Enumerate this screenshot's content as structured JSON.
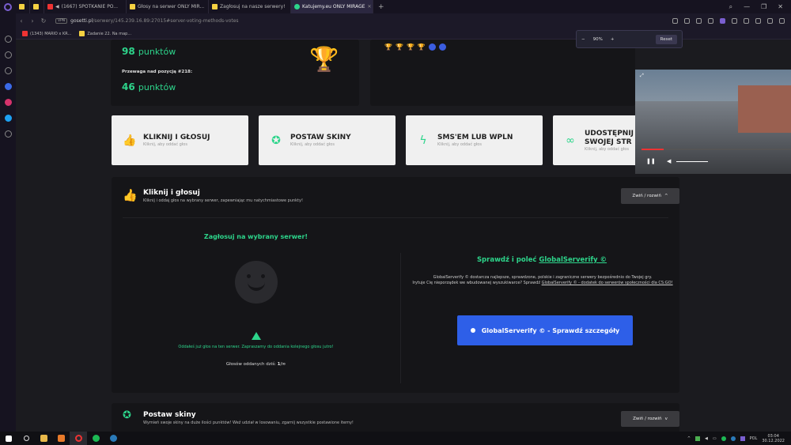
{
  "browser": {
    "tabs": [
      {
        "label": "(1667) SPOTKANIE PO...",
        "color": "#e33"
      },
      {
        "label": "Głosy na serwer ONLY MIR...",
        "color": "#f5d142"
      },
      {
        "label": "Zagłosuj na nasze serwery!",
        "color": "#f5d142"
      },
      {
        "label": "Katujemy.eu ONLY MIRAGE",
        "color": "#2dd58b"
      }
    ],
    "url_host": "gosetti.pl",
    "url_path": "/serwery/145.239.16.89:27015#server-voting-methods-votes",
    "vpn_label": "VPN",
    "bookmarks": [
      "(1343) MARIO x KR...",
      "Zadanie 22. Na map..."
    ],
    "zoom": {
      "minus": "−",
      "value": "90%",
      "plus": "+",
      "reset": "Reset"
    }
  },
  "stats": {
    "points_top": "98",
    "points_unit": "punktów",
    "lead_label": "Przewaga nad pozycją #218:",
    "lead_points": "46",
    "lead_unit": "punktów"
  },
  "vote_cards": [
    {
      "title": "KLIKNIJ I GŁOSUJ",
      "sub": "Kliknij, aby oddać głos",
      "icon": "thumbs-up-icon"
    },
    {
      "title": "POSTAW SKINY",
      "sub": "Kliknij, aby oddać głos",
      "icon": "medal-icon"
    },
    {
      "title": "SMS'EM LUB WPLN",
      "sub": "Kliknij, aby oddać głos",
      "icon": "bolt-icon"
    },
    {
      "title": "UDOSTĘPNIJ SWOJEJ STR",
      "sub": "Kliknij, aby oddać głos",
      "icon": "link-icon"
    }
  ],
  "click_section": {
    "title": "Kliknij i głosuj",
    "sub": "Kliknij i oddaj głos na wybrany serwer, zapewniając mu natychmiastowe punkty!",
    "collapse": "Zwiń / rozwiń",
    "left_heading": "Zagłosuj na wybrany serwer!",
    "already_voted": "Oddałeś już głos na ten serwer. Zapraszamy do oddania kolejnego głosu jutro!",
    "votes_today_label": "Głosów oddanych dziś:",
    "votes_today_value": "1/∞",
    "right_heading_prefix": "Sprawdź i poleć",
    "right_heading_link": "GlobalServerify ©",
    "desc_1": "GlobalServerify © dostarcza najlepsze, sprawdzone, polskie i zagraniczne serwery bezpośrednio do Twojej gry.",
    "desc_2": "Irytuje Cię nieporządek we wbudowanej wyszukiwarce? Sprawdź",
    "desc_link": "GlobalServerify © - dodatek do serwerów społeczności dla CS:GO!",
    "button": "GlobalServerify © - Sprawdź szczegóły"
  },
  "skins_section": {
    "title": "Postaw skiny",
    "sub": "Wymień swoje skiny na duże ilości punktów! Weź udział w losowaniu, zgarnij wszystkie postawione itemy!",
    "collapse": "Zwiń / rozwiń"
  },
  "taskbar": {
    "lang": "POL",
    "time": "03:04",
    "date": "30.12.2022"
  }
}
